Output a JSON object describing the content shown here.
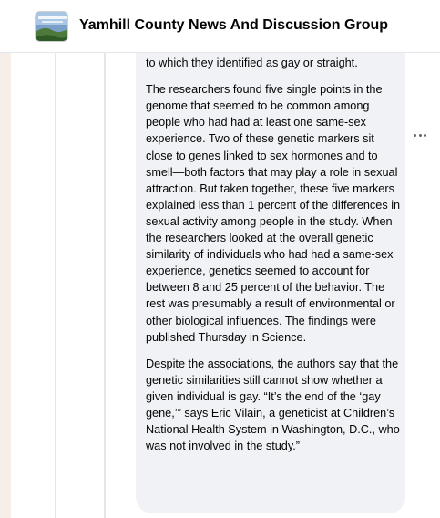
{
  "header": {
    "group_name": "Yamhill County News And Discussion Group"
  },
  "comment": {
    "paragraphs": [
      "questions about sexual fantasies and the degree to which they identified as gay or straight.",
      "The researchers found five single points in the genome that seemed to be common among people who had had at least one same-sex experience. Two of these genetic markers sit close to genes linked to sex hormones and to smell—both factors that may play a role in sexual attraction. But taken together, these five markers explained less than 1 percent of the differences in sexual activity among people in the study. When the researchers looked at the overall genetic similarity of individuals who had had a same-sex experience, genetics seemed to account for between 8 and 25 percent of the behavior. The rest was presumably a result of environmental or other biological influences. The findings were published Thursday in Science.",
      "Despite the associations, the authors say that the genetic similarities still cannot show whether a given individual is gay. “It’s the end of the ‘gay gene,’” says Eric Vilain, a geneticist at Children’s National Health System in Washington, D.C., who was not involved in the study.”"
    ]
  },
  "icons": {
    "more": "more-options-icon",
    "group_avatar": "group-cover-image"
  },
  "colors": {
    "bubble_bg": "#f0f2f5",
    "text": "#050505",
    "secondary": "#65676b",
    "left_strip": "#f7ede9"
  }
}
